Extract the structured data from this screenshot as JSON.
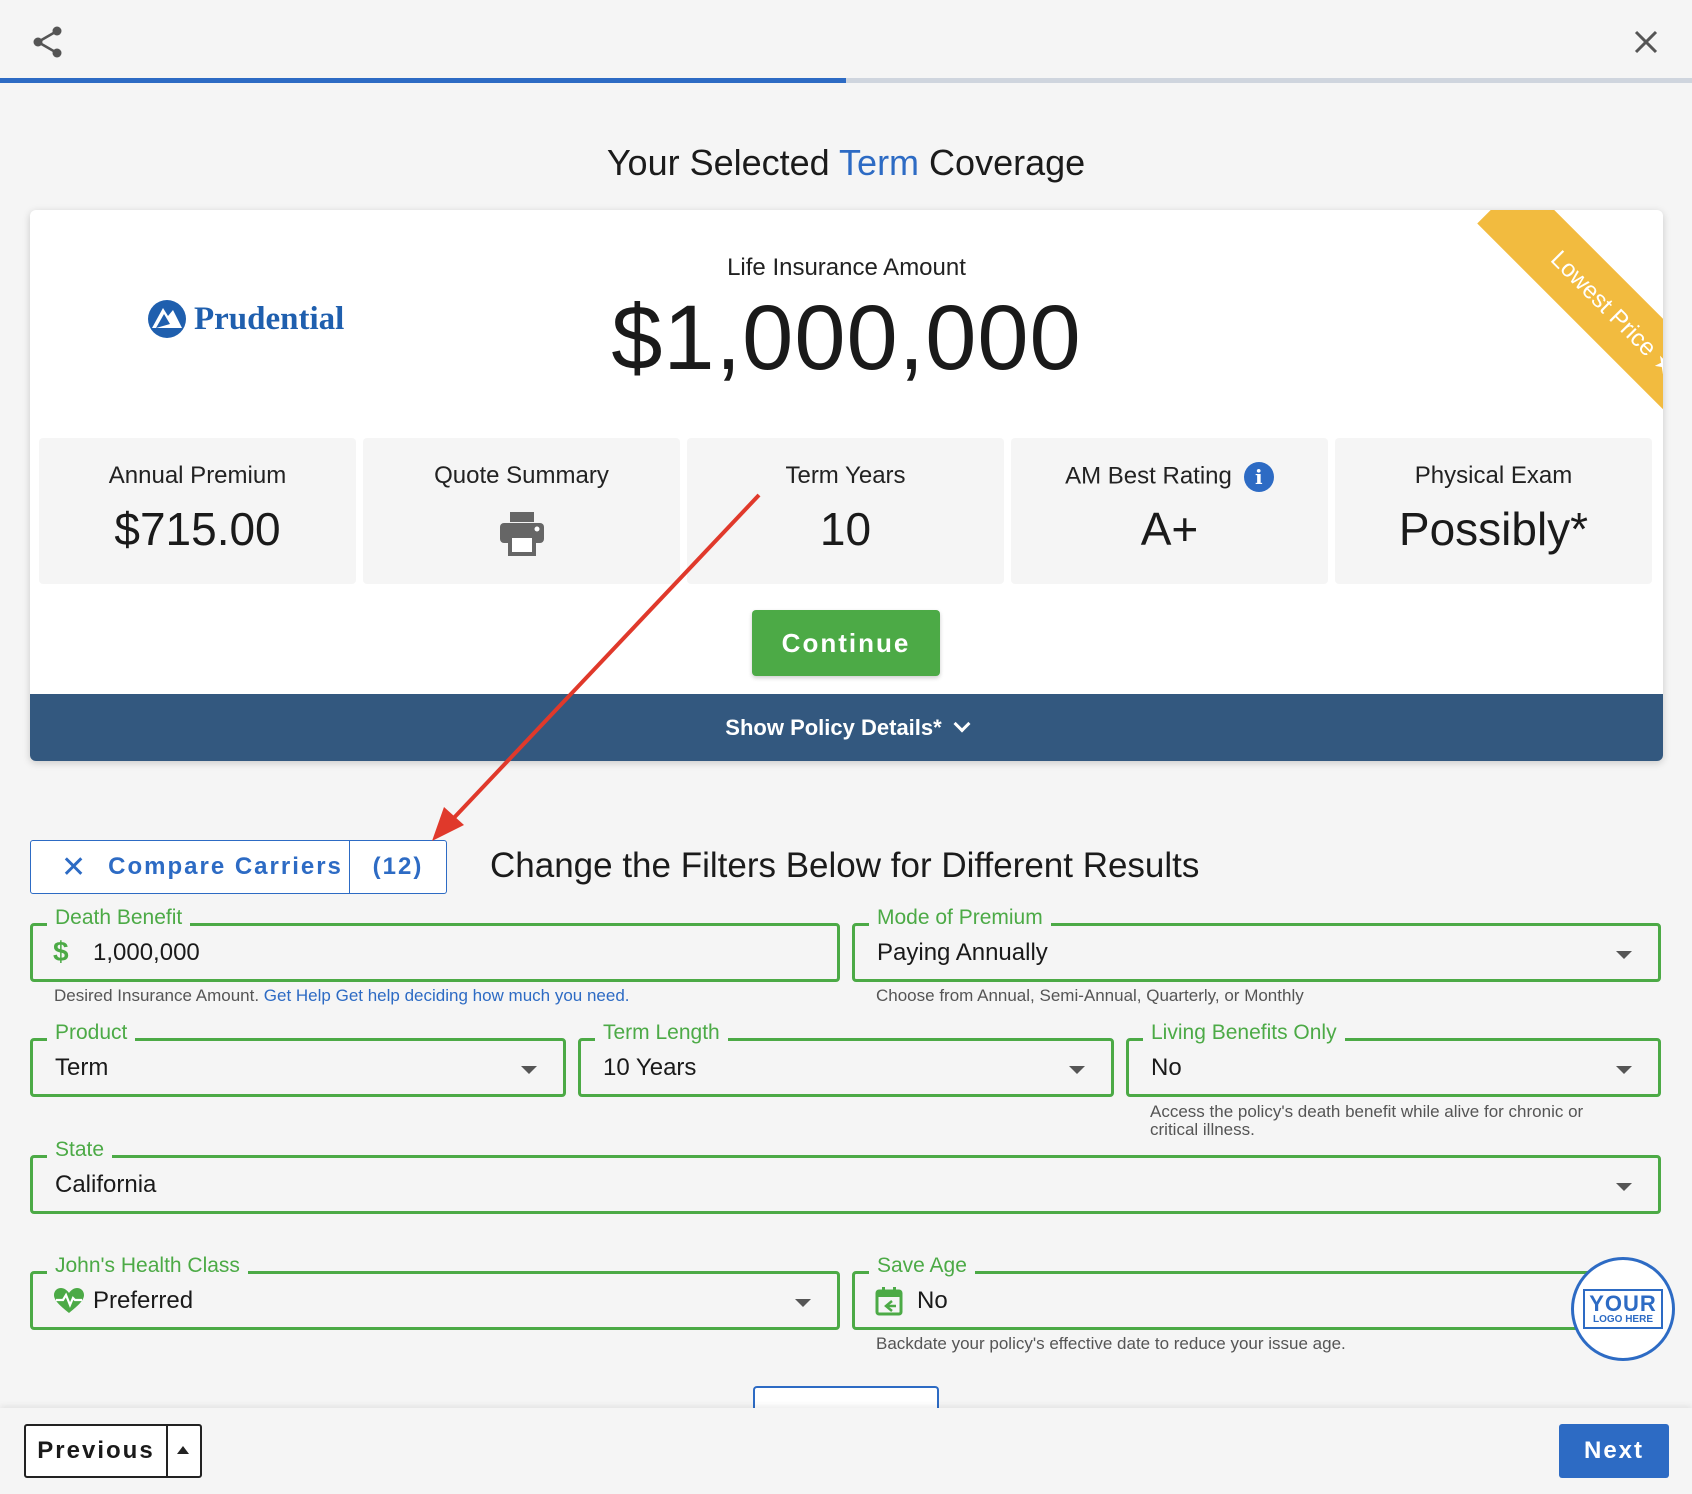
{
  "header": {
    "progress_percent": 50
  },
  "title": {
    "prefix": "Your Selected ",
    "accent": "Term",
    "suffix": " Coverage"
  },
  "coverage": {
    "carrier_logo_text": "Prudential",
    "amount_label": "Life Insurance Amount",
    "amount_value": "$1,000,000",
    "ribbon": "Lowest Price",
    "stats": [
      {
        "label": "Annual Premium",
        "value": "$715.00"
      },
      {
        "label": "Quote Summary",
        "icon": "print-icon"
      },
      {
        "label": "Term Years",
        "value": "10"
      },
      {
        "label": "AM Best Rating",
        "value": "A+",
        "icon": "info-icon"
      },
      {
        "label": "Physical Exam",
        "value": "Possibly*"
      }
    ],
    "continue_label": "Continue",
    "details_label": "Show Policy Details*"
  },
  "filters": {
    "compare_label": "Compare Carriers",
    "compare_count": "(12)",
    "heading": "Change the Filters Below for Different Results",
    "death_benefit": {
      "label": "Death Benefit",
      "value": "1,000,000",
      "hint": "Desired Insurance Amount. ",
      "hint_link": "Get Help Get help deciding how much you need."
    },
    "mode": {
      "label": "Mode of Premium",
      "value": "Paying Annually",
      "hint": "Choose from Annual, Semi-Annual, Quarterly, or Monthly"
    },
    "product": {
      "label": "Product",
      "value": "Term"
    },
    "term_length": {
      "label": "Term Length",
      "value": "10 Years"
    },
    "living_benefits": {
      "label": "Living Benefits Only",
      "value": "No",
      "hint": "Access the policy's death benefit while alive for chronic or critical illness."
    },
    "state": {
      "label": "State",
      "value": "California"
    },
    "health_class": {
      "label": "John's Health Class",
      "value": "Preferred"
    },
    "save_age": {
      "label": "Save Age",
      "value": "No",
      "hint": "Backdate your policy's effective date to reduce your issue age."
    },
    "logo_badge": {
      "big": "YOUR",
      "small": "LOGO HERE"
    }
  },
  "footer": {
    "previous_label": "Previous",
    "next_label": "Next"
  },
  "colors": {
    "accent": "#2d6bc4",
    "green": "#4caa46",
    "navy": "#33587f",
    "ribbon": "#f2bb3f",
    "annotation": "#e0392b"
  }
}
